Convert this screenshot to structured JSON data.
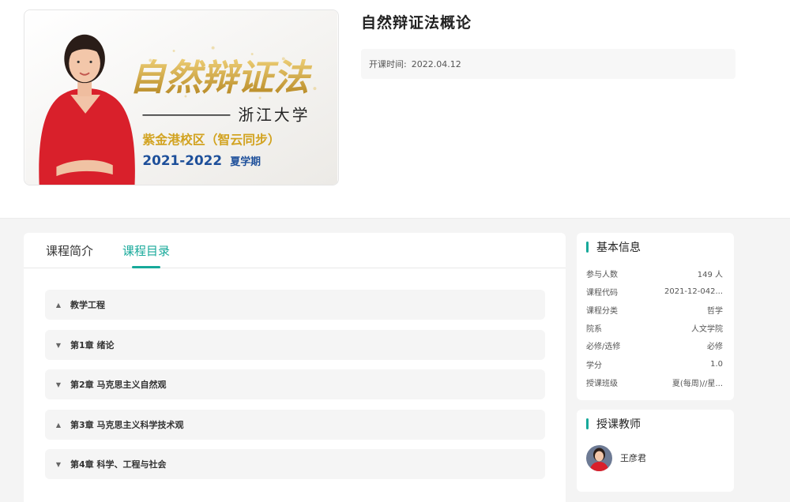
{
  "course": {
    "title": "自然辩证法概论",
    "start_label": "开课时间:",
    "start_date": "2022.04.12",
    "cover": {
      "title": "自然辩证法",
      "university": "浙江大学",
      "campus": "紫金港校区（智云同步）",
      "term_year": "2021-2022",
      "term_name": "夏学期"
    }
  },
  "tabs": [
    {
      "label": "课程简介",
      "active": false
    },
    {
      "label": "课程目录",
      "active": true
    }
  ],
  "chapters": [
    {
      "label": "教学工程"
    },
    {
      "label": "第1章 绪论"
    },
    {
      "label": "第2章 马克思主义自然观"
    },
    {
      "label": "第3章 马克思主义科学技术观"
    },
    {
      "label": "第4章 科学、工程与社会"
    }
  ],
  "basic_info": {
    "title": "基本信息",
    "rows": [
      {
        "label": "参与人数",
        "value": "149 人"
      },
      {
        "label": "课程代码",
        "value": "2021-12-042..."
      },
      {
        "label": "课程分类",
        "value": "哲学"
      },
      {
        "label": "院系",
        "value": "人文学院"
      },
      {
        "label": "必修/选修",
        "value": "必修"
      },
      {
        "label": "学分",
        "value": "1.0"
      },
      {
        "label": "授课班级",
        "value": "夏(每周)//星..."
      }
    ]
  },
  "teacher": {
    "title": "授课教师",
    "name": "王彦君"
  },
  "colors": {
    "accent": "#17a99a",
    "cover_title_gold": "#c9a23a",
    "cover_campus_gold": "#d2a321",
    "cover_term_blue": "#1d4f9a",
    "teacher_dress_red": "#d9202b"
  }
}
